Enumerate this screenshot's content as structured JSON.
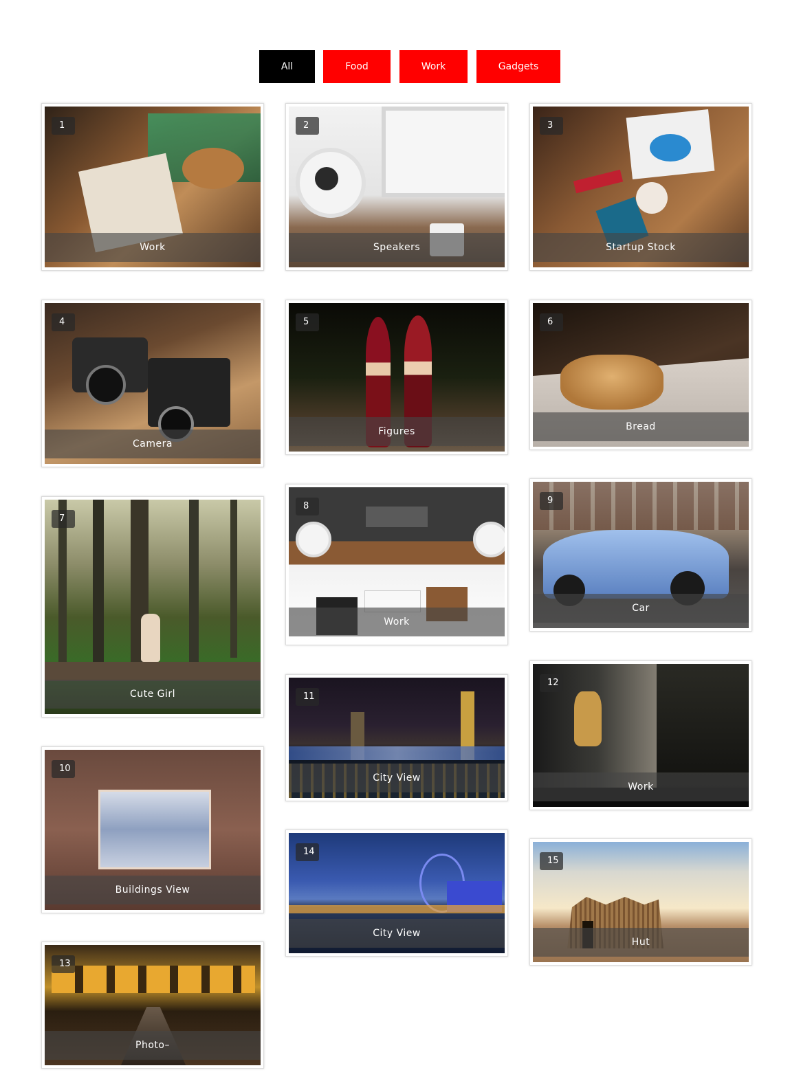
{
  "filters": [
    {
      "label": "All",
      "active": true
    },
    {
      "label": "Food",
      "active": false
    },
    {
      "label": "Work",
      "active": false
    },
    {
      "label": "Gadgets",
      "active": false
    }
  ],
  "gallery": {
    "items": [
      {
        "number": "1",
        "caption": "Work"
      },
      {
        "number": "2",
        "caption": "Speakers"
      },
      {
        "number": "3",
        "caption": "Startup Stock"
      },
      {
        "number": "4",
        "caption": "Camera"
      },
      {
        "number": "5",
        "caption": "Figures"
      },
      {
        "number": "6",
        "caption": "Bread"
      },
      {
        "number": "7",
        "caption": "Cute Girl"
      },
      {
        "number": "8",
        "caption": "Work"
      },
      {
        "number": "9",
        "caption": "Car"
      },
      {
        "number": "10",
        "caption": "Buildings View"
      },
      {
        "number": "11",
        "caption": "City View"
      },
      {
        "number": "12",
        "caption": "Work"
      },
      {
        "number": "13",
        "caption": "Photo–"
      },
      {
        "number": "14",
        "caption": "City View"
      },
      {
        "number": "15",
        "caption": "Hut"
      }
    ]
  },
  "colors": {
    "filter_active": "#000000",
    "filter_inactive": "#ff0000",
    "caption_overlay": "rgba(70,70,70,0.62)"
  }
}
